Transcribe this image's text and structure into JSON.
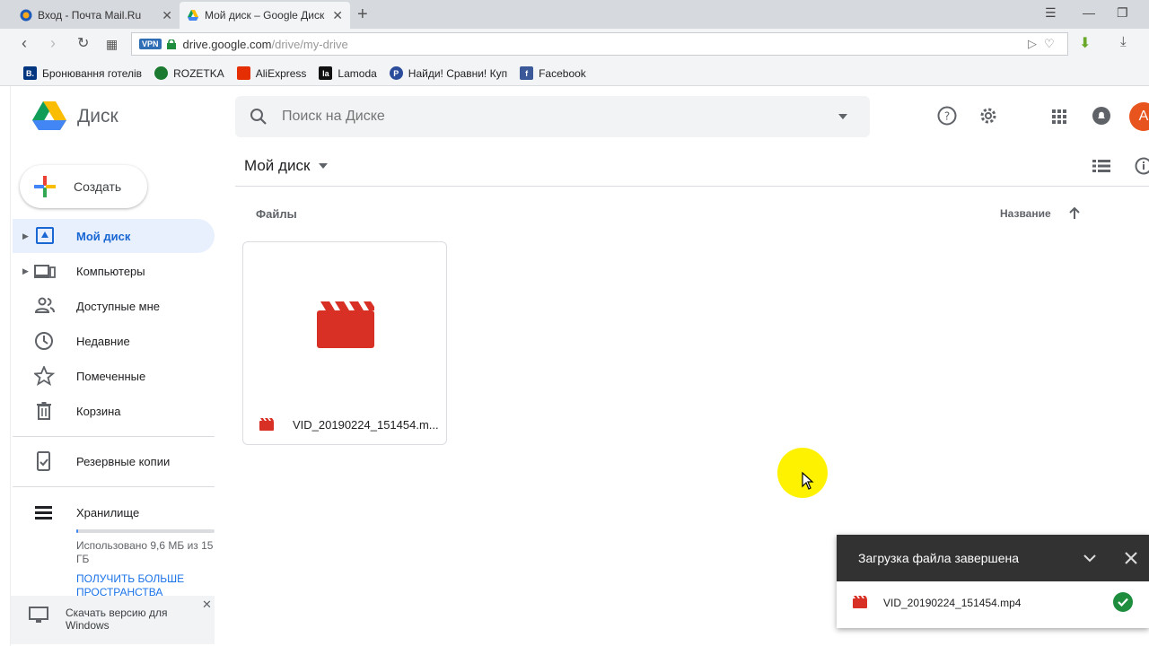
{
  "browser": {
    "tabs": [
      {
        "title": "Вход - Почта Mail.Ru",
        "active": false
      },
      {
        "title": "Мой диск – Google Диск",
        "active": true
      }
    ],
    "address": {
      "vpn_badge": "VPN",
      "host": "drive.google.com",
      "path": "/drive/my-drive"
    },
    "bookmarks": [
      {
        "label": "Бронювання готелів",
        "icon_text": "B.",
        "color": "#003580"
      },
      {
        "label": "ROZETKA",
        "icon_text": "",
        "color": "#1b7a2f"
      },
      {
        "label": "AliExpress",
        "icon_text": "",
        "color": "#e62e04"
      },
      {
        "label": "Lamoda",
        "icon_text": "la",
        "color": "#111111"
      },
      {
        "label": "Найди! Сравни! Куп",
        "icon_text": "P",
        "color": "#2b4c9a"
      },
      {
        "label": "Facebook",
        "icon_text": "f",
        "color": "#3b5998"
      }
    ]
  },
  "drive": {
    "logo_text": "Диск",
    "search_placeholder": "Поиск на Диске",
    "avatar_letter": "A",
    "create_label": "Создать",
    "nav": [
      {
        "label": "Мой диск",
        "icon": "my-drive-icon",
        "active": true,
        "expandable": true
      },
      {
        "label": "Компьютеры",
        "icon": "computers-icon",
        "active": false,
        "expandable": true
      },
      {
        "label": "Доступные мне",
        "icon": "shared-icon",
        "active": false,
        "expandable": false
      },
      {
        "label": "Недавние",
        "icon": "clock-icon",
        "active": false,
        "expandable": false
      },
      {
        "label": "Помеченные",
        "icon": "star-icon",
        "active": false,
        "expandable": false
      },
      {
        "label": "Корзина",
        "icon": "trash-icon",
        "active": false,
        "expandable": false
      },
      {
        "label": "Резервные копии",
        "icon": "backup-icon",
        "active": false,
        "expandable": false
      },
      {
        "label": "Хранилище",
        "icon": "storage-icon",
        "active": false,
        "expandable": false
      }
    ],
    "storage": {
      "used_text": "Использовано 9,6 МБ из 15 ГБ",
      "used_fraction": 0.0006,
      "upgrade_link": "ПОЛУЧИТЬ БОЛЬШЕ ПРОСТРАНСТВА"
    },
    "download_banner": {
      "text": "Скачать версию для Windows"
    },
    "main": {
      "title": "Мой диск",
      "section_label": "Файлы",
      "sort_label": "Название",
      "files": [
        {
          "name": "VID_20190224_151454.m...",
          "type": "video"
        }
      ]
    },
    "upload_panel": {
      "title": "Загрузка файла завершена",
      "items": [
        {
          "name": "VID_20190224_151454.mp4",
          "status": "done"
        }
      ]
    }
  },
  "colors": {
    "accent": "#1967d2",
    "video_red": "#d93025",
    "success": "#1e8e3e"
  }
}
